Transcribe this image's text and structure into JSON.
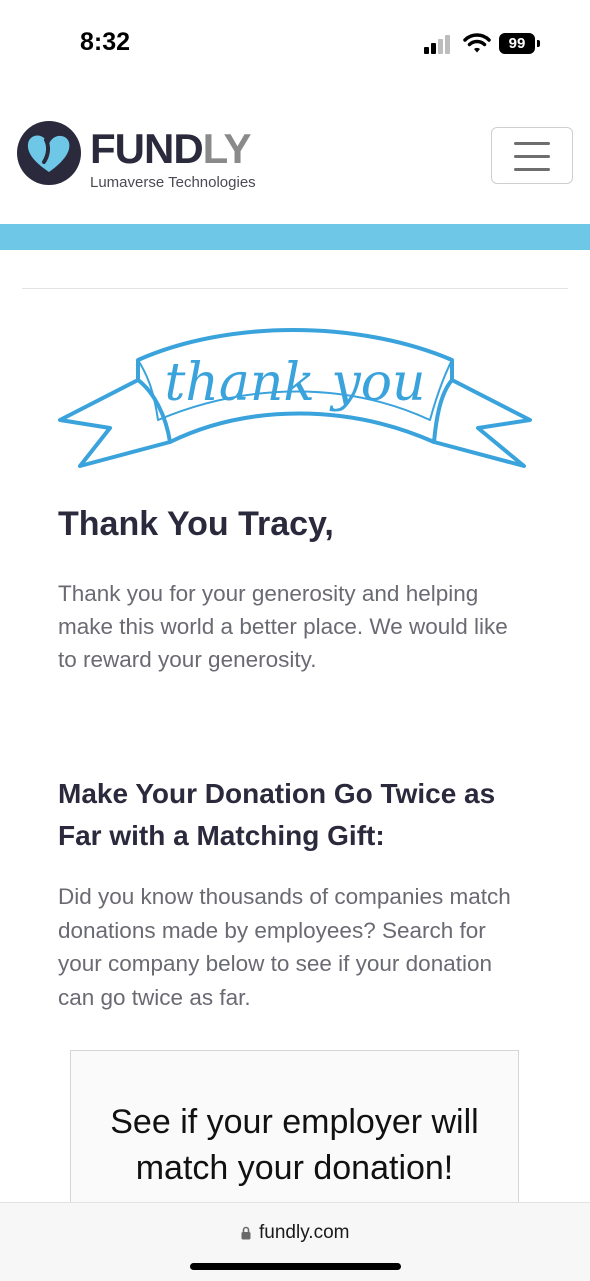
{
  "status_bar": {
    "time": "8:32",
    "battery": "99"
  },
  "header": {
    "logo_main_dark": "FUND",
    "logo_main_light": "LY",
    "logo_subtitle": "Lumaverse Technologies",
    "brand_color": "#2b2a3d",
    "accent_color": "#6ec7e6"
  },
  "banner": {
    "text": "thank you",
    "color": "#3aa3dc"
  },
  "thank_you": {
    "heading": "Thank You Tracy,",
    "body": "Thank you for your generosity and helping make this world a better place. We would like to reward your generosity."
  },
  "matching": {
    "heading": "Make Your Donation Go Twice as Far with a Matching Gift:",
    "body": "Did you know thousands of companies match donations made by employees? Search for your company below to see if your donation can go twice as far."
  },
  "employer_card": {
    "text": "See if your employer will match your donation!"
  },
  "browser": {
    "url": "fundly.com"
  }
}
